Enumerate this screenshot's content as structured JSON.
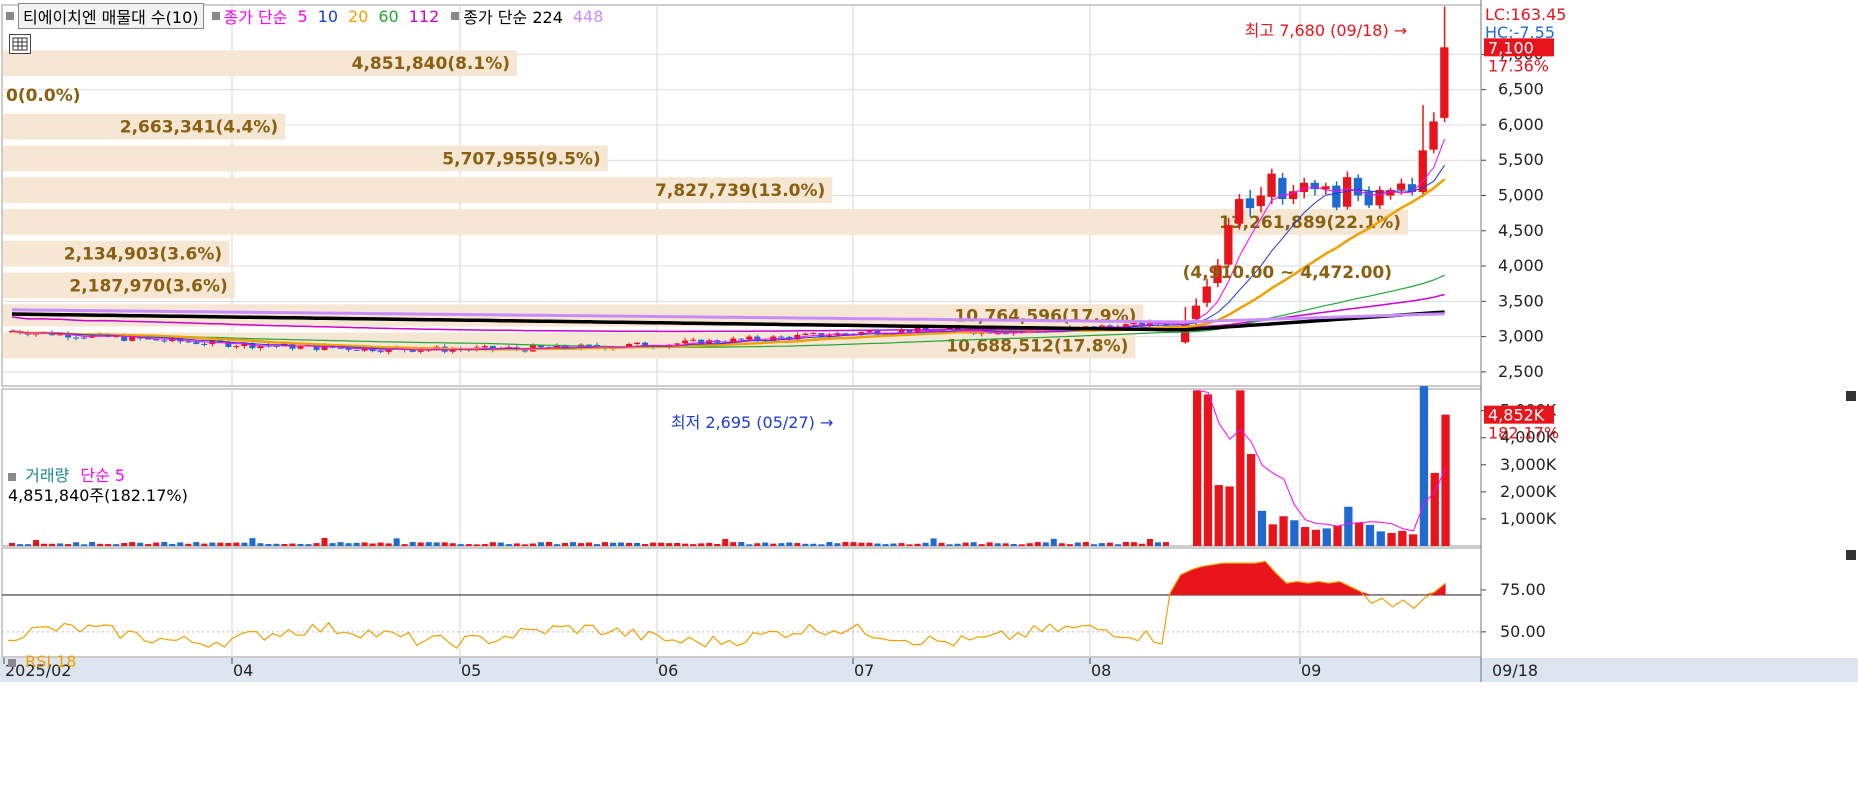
{
  "header": {
    "series_title": "티에이치엔 매물대 수(10)",
    "ma_label": "종가 단순",
    "ma_periods": [
      {
        "label": "5",
        "color": "#ff00ff"
      },
      {
        "label": "10",
        "color": "#1a3cd6"
      },
      {
        "label": "20",
        "color": "#f0a000"
      },
      {
        "label": "60",
        "color": "#21a637"
      },
      {
        "label": "112",
        "color": "#d000d0"
      }
    ],
    "ma2_label": "종가 단순 224",
    "ma2_period_extra": {
      "label": "448",
      "color": "#c88cff"
    }
  },
  "right_labels": {
    "lc": "LC:163.45",
    "hc": "HC:-7.55",
    "last_price": "7,100",
    "last_change": "17.36%",
    "vol_last": "4,852K",
    "vol_change": "182.17%"
  },
  "annotations": {
    "high": "최고 7,680 (09/18)",
    "low": "최저 2,695 (05/27)",
    "volume_profile_range": "(4,910.00 ~ 4,472.00)"
  },
  "volume_panel": {
    "legend_vol": "거래량",
    "legend_ma": "단순 5",
    "current": "4,851,840주(182.17%)"
  },
  "rsi_panel": {
    "legend": "RSI 18"
  },
  "chart_data": {
    "type": "candlestick",
    "x_ticks": [
      "2025/02",
      "04",
      "05",
      "06",
      "07",
      "08",
      "09",
      "09/18"
    ],
    "price_axis": {
      "ticks": [
        "2,500",
        "3,000",
        "3,500",
        "4,000",
        "4,500",
        "5,000",
        "5,500",
        "6,000",
        "6,500",
        "7,000"
      ],
      "range": [
        2300,
        7700
      ]
    },
    "volume_profile": [
      {
        "label": "10,688,512(17.8%)",
        "price_range": [
          2650,
          3100
        ]
      },
      {
        "label": "10,764,596(17.9%)",
        "price_range": [
          3100,
          3500
        ]
      },
      {
        "label": "2,187,970(3.6%)",
        "price_range": [
          3500,
          3950
        ]
      },
      {
        "label": "2,134,903(3.6%)",
        "price_range": [
          3950,
          4400
        ]
      },
      {
        "label": "13,261,889(22.1%)",
        "price_range": [
          4400,
          4850
        ]
      },
      {
        "label": "7,827,739(13.0%)",
        "price_range": [
          4850,
          5300
        ]
      },
      {
        "label": "5,707,955(9.5%)",
        "price_range": [
          5300,
          5750
        ]
      },
      {
        "label": "2,663,341(4.4%)",
        "price_range": [
          5750,
          6200
        ]
      },
      {
        "label": "0(0.0%)",
        "price_range": [
          6200,
          6650
        ]
      },
      {
        "label": "4,851,840(8.1%)",
        "price_range": [
          6650,
          7100
        ]
      }
    ],
    "late_candles": [
      {
        "date": "08/19",
        "open": 2920,
        "close": 3180,
        "high": 3420,
        "low": 2900
      },
      {
        "date": "08/20",
        "open": 3250,
        "close": 3440,
        "high": 3540,
        "low": 3150
      },
      {
        "date": "08/21",
        "open": 3480,
        "close": 3710,
        "high": 3820,
        "low": 3420
      },
      {
        "date": "08/22",
        "open": 3760,
        "close": 4010,
        "high": 4100,
        "low": 3700
      },
      {
        "date": "08/25",
        "open": 4020,
        "close": 4580,
        "high": 4680,
        "low": 3980
      },
      {
        "date": "08/26",
        "open": 4600,
        "close": 4950,
        "high": 5020,
        "low": 4520
      },
      {
        "date": "08/27",
        "open": 4960,
        "close": 4820,
        "high": 5080,
        "low": 4700
      },
      {
        "date": "08/28",
        "open": 4850,
        "close": 5000,
        "high": 5120,
        "low": 4760
      },
      {
        "date": "08/29",
        "open": 4980,
        "close": 5310,
        "high": 5380,
        "low": 4880
      },
      {
        "date": "09/01",
        "open": 5250,
        "close": 4950,
        "high": 5320,
        "low": 4870
      },
      {
        "date": "09/02",
        "open": 4950,
        "close": 5060,
        "high": 5150,
        "low": 4880
      },
      {
        "date": "09/03",
        "open": 5050,
        "close": 5180,
        "high": 5250,
        "low": 4960
      },
      {
        "date": "09/04",
        "open": 5180,
        "close": 5090,
        "high": 5220,
        "low": 5000
      },
      {
        "date": "09/05",
        "open": 5090,
        "close": 5130,
        "high": 5180,
        "low": 5020
      },
      {
        "date": "09/08",
        "open": 5140,
        "close": 4830,
        "high": 5200,
        "low": 4790
      },
      {
        "date": "09/09",
        "open": 4840,
        "close": 5260,
        "high": 5340,
        "low": 4800
      },
      {
        "date": "09/10",
        "open": 5250,
        "close": 5000,
        "high": 5300,
        "low": 4920
      },
      {
        "date": "09/11",
        "open": 5060,
        "close": 4860,
        "high": 5130,
        "low": 4820
      },
      {
        "date": "09/12",
        "open": 4860,
        "close": 5080,
        "high": 5130,
        "low": 4810
      },
      {
        "date": "09/15",
        "open": 5000,
        "close": 5080,
        "high": 5110,
        "low": 4940
      },
      {
        "date": "09/16",
        "open": 5080,
        "close": 5170,
        "high": 5240,
        "low": 5010
      },
      {
        "date": "09/16b",
        "open": 5160,
        "close": 5050,
        "high": 5250,
        "low": 5000
      },
      {
        "date": "09/17",
        "open": 5050,
        "close": 5640,
        "high": 6280,
        "low": 4980
      },
      {
        "date": "09/17b",
        "open": 5650,
        "close": 6050,
        "high": 6180,
        "low": 5600
      },
      {
        "date": "09/18",
        "open": 6100,
        "close": 7100,
        "high": 7680,
        "low": 6040
      }
    ],
    "volume_axis": {
      "ticks": [
        "1,000K",
        "2,000K",
        "3,000K",
        "4,000K",
        "5,000K"
      ],
      "range": [
        0,
        5800
      ]
    },
    "late_volume_k": [
      5750,
      5600,
      2250,
      2200,
      5750,
      3400,
      1300,
      800,
      1100,
      950,
      700,
      600,
      650,
      750,
      1450,
      850,
      780,
      540,
      480,
      560,
      430,
      5900,
      2700,
      4852
    ],
    "rsi_axis": {
      "ticks": [
        "50.00",
        "75.00"
      ],
      "range": [
        35,
        100
      ],
      "signal": 72
    },
    "late_rsi": [
      73,
      84,
      87,
      89,
      90,
      91,
      91,
      91,
      91,
      92,
      85,
      79,
      80,
      79,
      80,
      79,
      80,
      77,
      74,
      67,
      70,
      65,
      69,
      64,
      70,
      74,
      79
    ]
  },
  "colors": {
    "up": "#e8141b",
    "down": "#1f6ad0",
    "profile": "#f5e7d3",
    "ma224": "#000000",
    "ma448": "#c88cff",
    "rsi": "#f0a000"
  }
}
